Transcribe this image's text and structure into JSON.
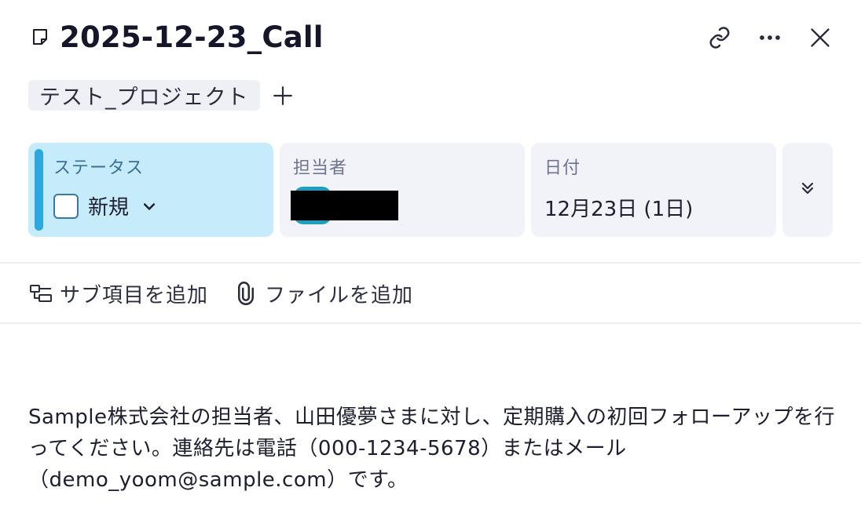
{
  "header": {
    "title": "2025-12-23_Call",
    "icons": [
      "note-icon",
      "link-icon",
      "more-icon",
      "close-icon"
    ]
  },
  "tags": {
    "items": [
      {
        "label": "テスト_プロジェクト"
      }
    ],
    "add_icon": "plus-icon"
  },
  "properties": {
    "status": {
      "label": "ステータス",
      "value": "新規",
      "accent": "#2ea6e0"
    },
    "assignee": {
      "label": "担当者"
    },
    "date": {
      "label": "日付",
      "value": "12月23日 (1日)"
    },
    "expand_icon": "double-chevron-down-icon"
  },
  "actions": {
    "add_subitem": "サブ項目を追加",
    "add_file": "ファイルを追加"
  },
  "description": {
    "text": "Sample株式会社の担当者、山田優夢さまに対し、定期購入の初回フォローアップを行ってください。連絡先は電話（000-1234-5678）またはメール（demo_yoom@sample.com）です。"
  }
}
